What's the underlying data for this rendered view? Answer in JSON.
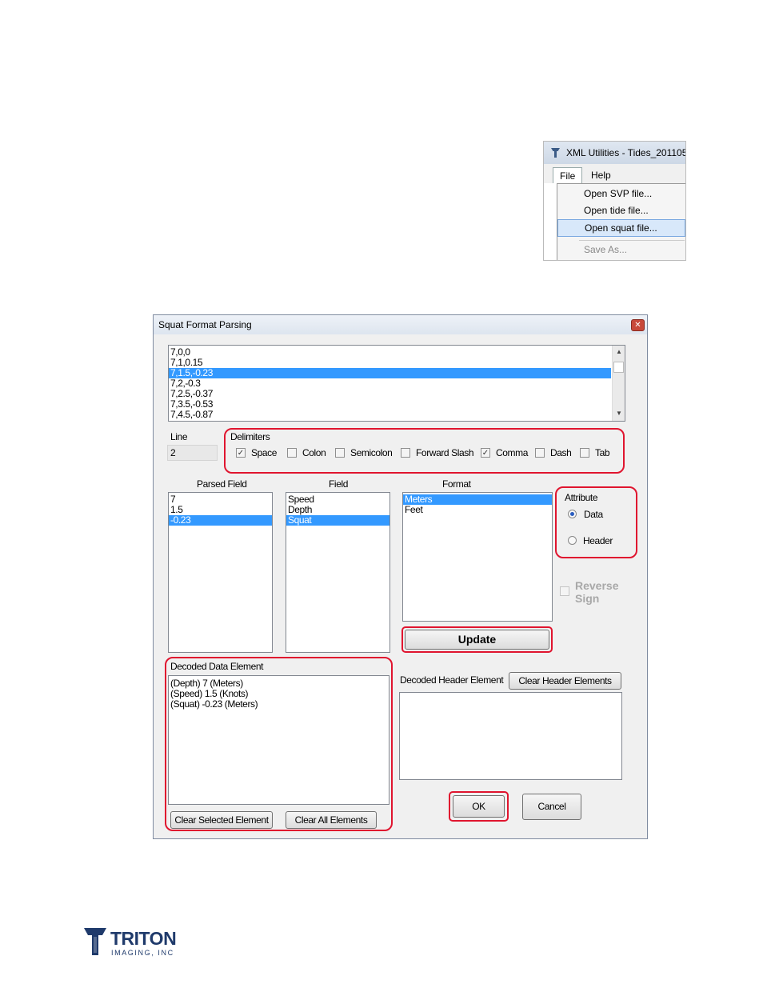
{
  "menu_screenshot": {
    "window_title": "XML Utilities - Tides_201105",
    "menus": [
      "File",
      "Help"
    ],
    "items": [
      {
        "label": "Open SVP file...",
        "state": "normal"
      },
      {
        "label": "Open tide file...",
        "state": "normal"
      },
      {
        "label": "Open squat file...",
        "state": "highlighted"
      },
      {
        "label": "Save As...",
        "state": "disabled"
      }
    ]
  },
  "dialog": {
    "title": "Squat Format Parsing",
    "raw_lines": [
      "7,0,0",
      "7,1,0.15",
      "7,1.5,-0.23",
      "7,2,-0.3",
      "7,2.5,-0.37",
      "7,3.5,-0.53",
      "7,4.5,-0.87"
    ],
    "selected_line_index": 2,
    "line_label": "Line",
    "line_value": "2",
    "delimiters_label": "Delimiters",
    "delimiters": [
      {
        "label": "Space",
        "checked": true
      },
      {
        "label": "Colon",
        "checked": false
      },
      {
        "label": "Semicolon",
        "checked": false
      },
      {
        "label": "Forward Slash",
        "checked": false
      },
      {
        "label": "Comma",
        "checked": true
      },
      {
        "label": "Dash",
        "checked": false
      },
      {
        "label": "Tab",
        "checked": false
      }
    ],
    "parsed_field_label": "Parsed Field",
    "parsed_fields": [
      "7",
      "1.5",
      "-0.23"
    ],
    "field_label": "Field",
    "fields": [
      "Speed",
      "Depth",
      "Squat"
    ],
    "format_label": "Format",
    "formats": [
      "Meters",
      "Feet"
    ],
    "attribute_label": "Attribute",
    "attribute_options": [
      {
        "label": "Data",
        "selected": true
      },
      {
        "label": "Header",
        "selected": false
      }
    ],
    "reverse_sign_label": "Reverse Sign",
    "update_label": "Update",
    "decoded_data_label": "Decoded Data Element",
    "decoded_data": [
      "(Depth) 7 (Meters)",
      "(Speed) 1.5 (Knots)",
      "(Squat) -0.23 (Meters)"
    ],
    "clear_selected_label": "Clear Selected Element",
    "clear_all_label": "Clear All Elements",
    "decoded_header_label": "Decoded Header Element",
    "clear_header_label": "Clear Header Elements",
    "ok_label": "OK",
    "cancel_label": "Cancel"
  },
  "logo": {
    "name": "TRITON",
    "subtitle": "IMAGING, INC"
  },
  "colors": {
    "highlight_outline": "#e0152f",
    "selection": "#3399ff",
    "logo": "#1f3a6b"
  }
}
